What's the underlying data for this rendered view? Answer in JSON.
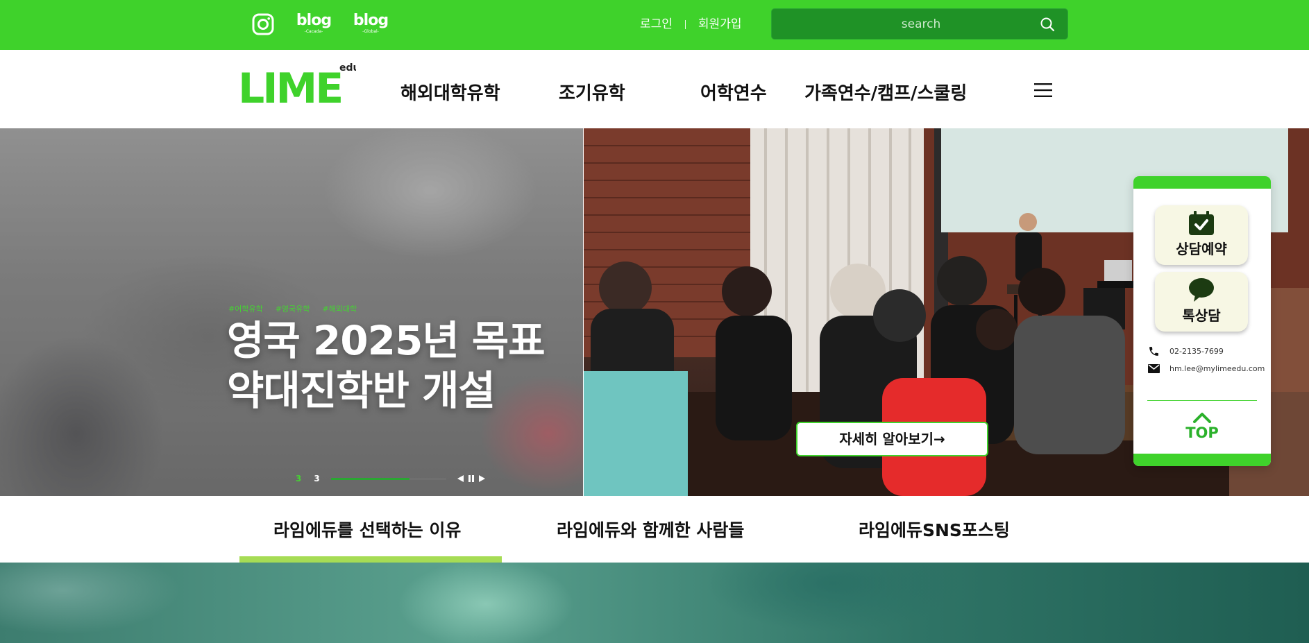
{
  "topbar": {
    "social": [
      {
        "icon": "instagram-icon"
      },
      {
        "label": "blog",
        "sub": "-Cacada-"
      },
      {
        "label": "blog",
        "sub": "-Global-"
      }
    ],
    "login": "로그인",
    "signup": "회원가입",
    "search_placeholder": "search",
    "search_icon": "search-icon"
  },
  "header": {
    "logo_text": "LIME",
    "logo_sup": "edu",
    "nav": [
      "해외대학유학",
      "조기유학",
      "어학연수",
      "가족연수/캠프/스쿨링"
    ],
    "menu_icon": "hamburger-icon"
  },
  "hero": {
    "tags": [
      "#어학유학",
      "#영국유학",
      "#해외대학"
    ],
    "headline_line1": "영국 2025년 목표",
    "headline_line2": "약대진학반 개설",
    "slide_current": "3",
    "slide_total": "3",
    "progress": 0.68,
    "cta": "자세히 알아보기→"
  },
  "quick": {
    "reserve_label": "상담예약",
    "reserve_icon": "calendar-check-icon",
    "talk_label": "톡상담",
    "talk_icon": "chat-bubble-icon",
    "phone": "02-2135-7699",
    "email": "hm.lee@mylimeedu.com",
    "top_label": "TOP"
  },
  "tabs": [
    "라임에듀를 선택하는 이유",
    "라임에듀와 함께한 사람들",
    "라임에듀SNS포스팅"
  ],
  "colors": {
    "brand_green": "#3fd22b",
    "search_bg": "#1f9226",
    "tab_underline": "#a6dc55"
  }
}
